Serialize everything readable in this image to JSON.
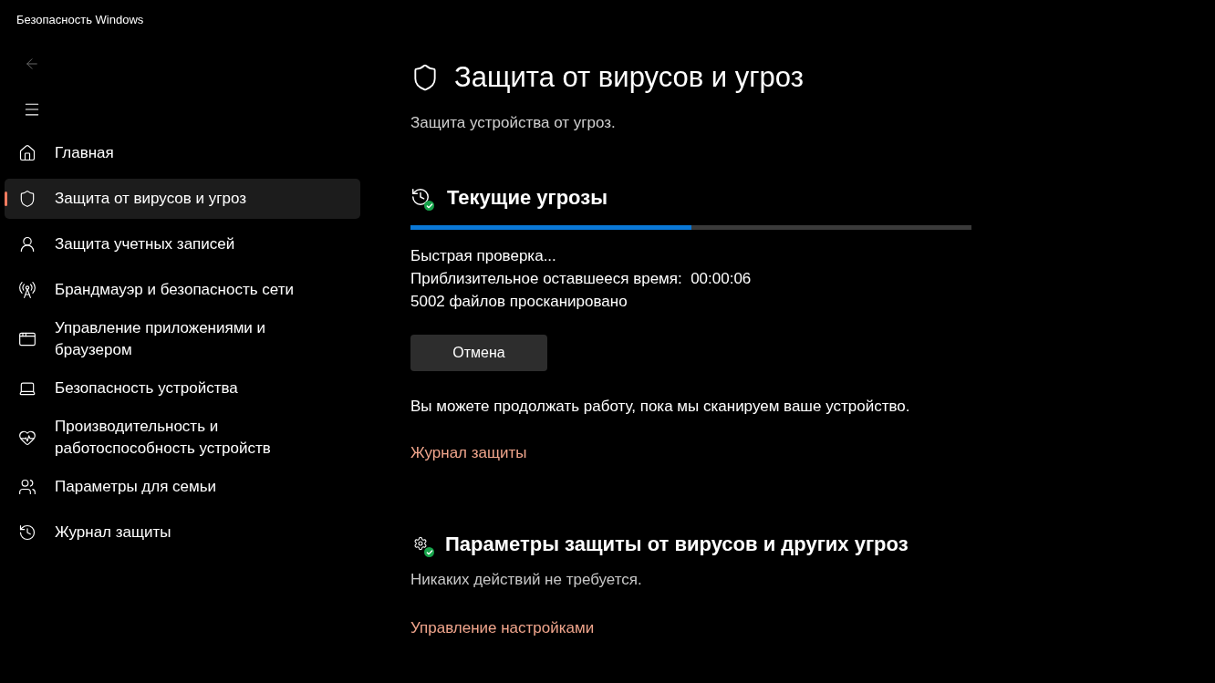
{
  "window": {
    "title": "Безопасность Windows"
  },
  "sidebar": {
    "items": [
      {
        "label": "Главная",
        "selected": false
      },
      {
        "label": "Защита от вирусов и угроз",
        "selected": true
      },
      {
        "label": "Защита учетных записей",
        "selected": false
      },
      {
        "label": "Брандмауэр и безопасность сети",
        "selected": false
      },
      {
        "label": "Управление приложениями и браузером",
        "selected": false
      },
      {
        "label": "Безопасность устройства",
        "selected": false
      },
      {
        "label": "Производительность и работоспособность устройств",
        "selected": false
      },
      {
        "label": "Параметры для семьи",
        "selected": false
      },
      {
        "label": "Журнал защиты",
        "selected": false
      }
    ]
  },
  "page": {
    "title": "Защита от вирусов и угроз",
    "subtitle": "Защита устройства от угроз."
  },
  "current_threats": {
    "heading": "Текущие угрозы",
    "progress": {
      "level": 0.5
    },
    "status_lines": [
      "Быстрая проверка...",
      "Приблизительное оставшееся время:  00:00:06",
      "5002 файлов просканировано"
    ],
    "cancel_button": "Отмена",
    "note": "Вы можете продолжать работу, пока мы сканируем ваше устройство.",
    "link": "Журнал защиты"
  },
  "settings_section": {
    "heading": "Параметры защиты от вирусов и других угроз",
    "status": "Никаких действий не требуется.",
    "link": "Управление настройками"
  }
}
